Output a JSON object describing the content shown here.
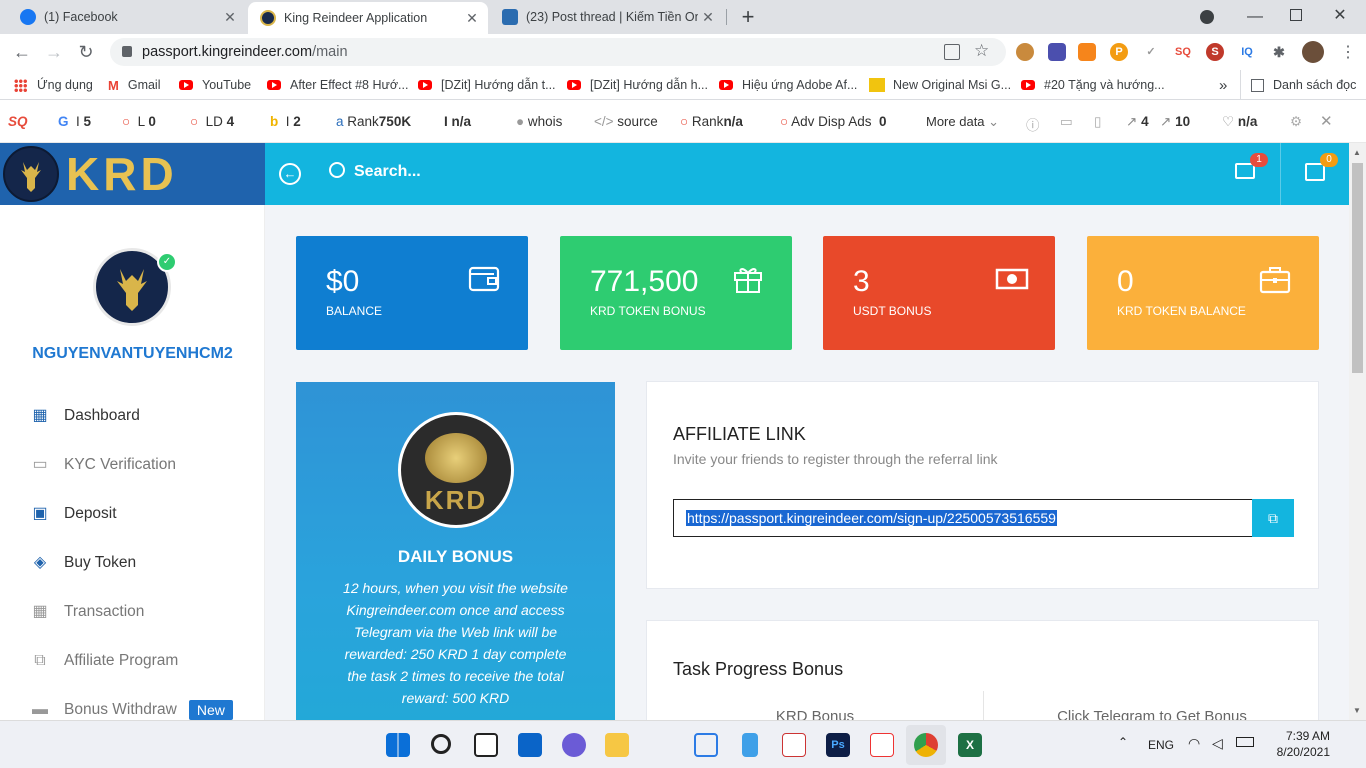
{
  "browser": {
    "tabs": [
      {
        "title": "(1) Facebook",
        "icon": "facebook-icon"
      },
      {
        "title": "King Reindeer Application",
        "icon": "krd-icon"
      },
      {
        "title": "(23) Post thread | Kiếm Tiền Onlin",
        "icon": "forum-icon"
      }
    ],
    "new_tab": "+",
    "url_host": "passport.kingreindeer.com",
    "url_path": "/main"
  },
  "bookmarks": {
    "apps": "Ứng dụng",
    "items": [
      "Gmail",
      "YouTube",
      "After Effect #8 Hướ...",
      "[DZit] Hướng dẫn t...",
      "[DZit] Hướng dẫn h...",
      "Hiệu ứng Adobe Af...",
      "New Original Msi G...",
      "#20 Tặng và hướng..."
    ],
    "more": "»",
    "reading_list": "Danh sách đọc"
  },
  "seoquake": {
    "g": "5",
    "l": "0",
    "ld": "4",
    "i": "2",
    "rank": "750K",
    "ia": "n/a",
    "whois": "whois",
    "source": "source",
    "rank2_label": "Rank",
    "rank2": "n/a",
    "adv_label": "Adv Disp Ads",
    "adv": "0",
    "more": "More data",
    "ext1": "4",
    "ext2": "10",
    "health": "n/a"
  },
  "app": {
    "logo": "KRD",
    "search_placeholder": "Search...",
    "messages_badge": "1",
    "calendar_badge": "0"
  },
  "sidebar": {
    "username": "NGUYENVANTUYENHCM2",
    "items": [
      {
        "label": "Dashboard",
        "icon": "dashboard-icon"
      },
      {
        "label": "KYC Verification",
        "icon": "monitor-icon"
      },
      {
        "label": "Deposit",
        "icon": "qr-icon"
      },
      {
        "label": "Buy Token",
        "icon": "cubes-icon"
      },
      {
        "label": "Transaction",
        "icon": "calendar-icon"
      },
      {
        "label": "Affiliate Program",
        "icon": "sitemap-icon"
      },
      {
        "label": "Bonus Withdraw",
        "icon": "card-icon",
        "badge": "New"
      }
    ]
  },
  "stats": [
    {
      "value": "$0",
      "label": "BALANCE",
      "color": "#0f7ed1",
      "icon": "wallet-icon"
    },
    {
      "value": "771,500",
      "label": "KRD TOKEN BONUS",
      "color": "#2ecc71",
      "icon": "gift-icon"
    },
    {
      "value": "3",
      "label": "USDT BONUS",
      "color": "#e8492a",
      "icon": "money-icon"
    },
    {
      "value": "0",
      "label": "KRD TOKEN BALANCE",
      "color": "#fbb03b",
      "icon": "briefcase-icon"
    }
  ],
  "daily_bonus": {
    "logo": "KRD",
    "title": "DAILY BONUS",
    "text": "12 hours, when you visit the website Kingreindeer.com once and access Telegram via the Web link will be rewarded: 250 KRD 1 day complete the task 2 times to receive the total reward: 500 KRD"
  },
  "affiliate": {
    "title": "AFFILIATE LINK",
    "subtitle": "Invite your friends to register through the referral link",
    "link": "https://passport.kingreindeer.com/sign-up/22500573516559"
  },
  "task": {
    "title": "Task Progress Bonus",
    "col1": "KRD Bonus",
    "col2": "Click Telegram to Get Bonus"
  },
  "taskbar": {
    "lang": "ENG",
    "time": "7:39 AM",
    "date": "8/20/2021"
  }
}
